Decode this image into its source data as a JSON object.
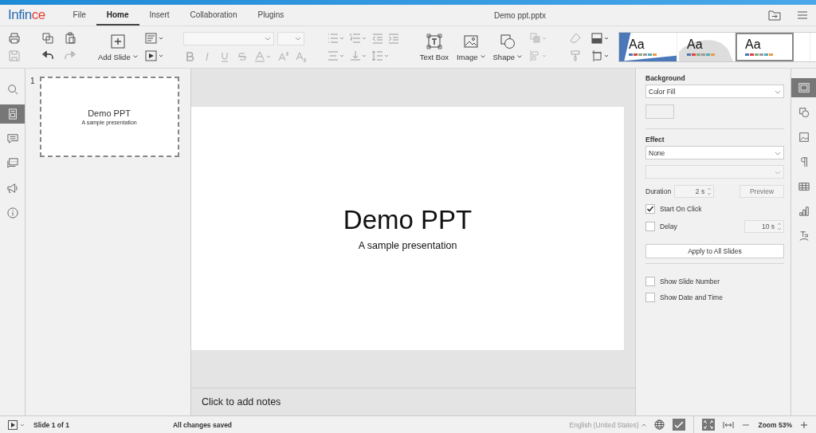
{
  "logo": {
    "text": "Infin",
    "accent": "ce"
  },
  "menu_tabs": [
    {
      "label": "File",
      "selected": false
    },
    {
      "label": "Home",
      "selected": true
    },
    {
      "label": "Insert",
      "selected": false
    },
    {
      "label": "Collaboration",
      "selected": false
    },
    {
      "label": "Plugins",
      "selected": false
    }
  ],
  "document_title": "Demo ppt.pptx",
  "toolbar": {
    "add_slide": "Add Slide",
    "text_box": "Text Box",
    "image": "Image",
    "shape": "Shape",
    "text_formatting_disabled": true
  },
  "themes": [
    {
      "label": "Aa",
      "selected": false
    },
    {
      "label": "Aa",
      "selected": false
    },
    {
      "label": "Aa",
      "selected": true
    }
  ],
  "left_rail": [
    {
      "selected": false
    },
    {
      "selected": true
    },
    {
      "selected": false
    },
    {
      "selected": false
    },
    {
      "selected": false
    },
    {
      "selected": false
    }
  ],
  "slides": [
    {
      "number": "1",
      "title": "Demo PPT",
      "subtitle": "A sample presentation",
      "selected": true
    }
  ],
  "slide": {
    "title": "Demo PPT",
    "subtitle": "A sample presentation"
  },
  "notes": {
    "placeholder": "Click to add notes"
  },
  "settings": {
    "background_label": "Background",
    "fill": "Color Fill",
    "effect_label": "Effect",
    "effect": "None",
    "duration_label": "Duration",
    "duration": {
      "value": "2 s",
      "disabled": true
    },
    "preview": {
      "label": "Preview",
      "disabled": true
    },
    "checks": [
      {
        "label": "Start On Click",
        "checked": true
      },
      {
        "label": "Delay",
        "checked": false
      }
    ],
    "delay": {
      "value": "10 s",
      "disabled": true
    },
    "apply_button": "Apply to All Slides",
    "options": [
      {
        "label": "Show Slide Number",
        "checked": false
      },
      {
        "label": "Show Date and Time",
        "checked": false
      }
    ]
  },
  "right_rail": [
    {
      "selected": true
    },
    {
      "selected": false
    },
    {
      "selected": false
    },
    {
      "selected": false
    },
    {
      "selected": false
    },
    {
      "selected": false
    },
    {
      "selected": false
    }
  ],
  "status_bar": {
    "slide_count": "Slide 1 of 1",
    "save_state": "All changes saved",
    "language": "English (United States)",
    "zoom": "Zoom 53%"
  }
}
